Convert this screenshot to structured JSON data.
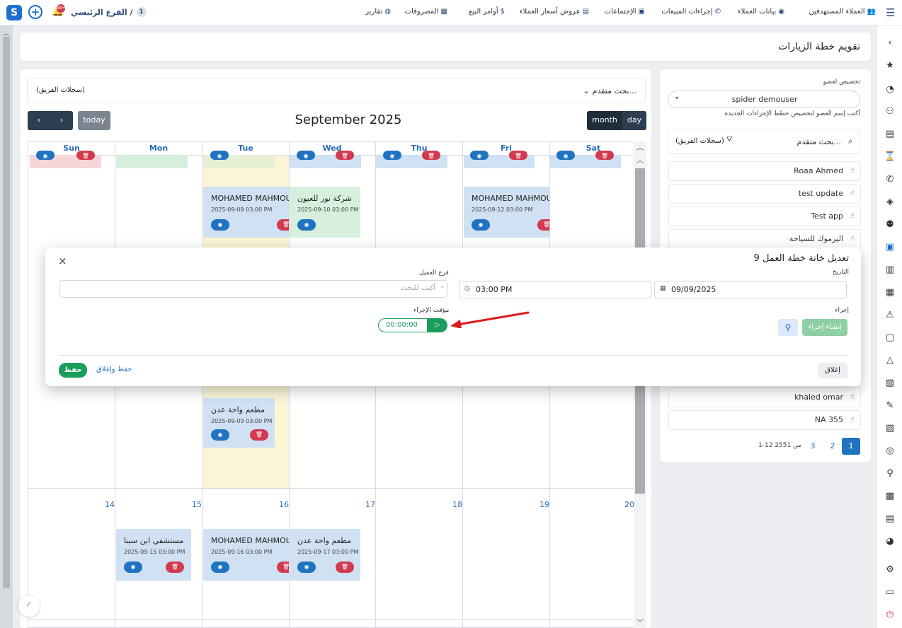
{
  "topbar": {
    "branch_label": "الفرع الرئيسي /",
    "branch_badge": "1",
    "notif_badge": "99+",
    "nav": [
      {
        "label": "العملاء المستهدفين"
      },
      {
        "label": "بيانات العملاء"
      },
      {
        "label": "إجراءات المبيعات"
      },
      {
        "label": "الإجتماعات"
      },
      {
        "label": "عروض أسعار العملاء"
      },
      {
        "label": "أوامر البيع"
      },
      {
        "label": "المصروفات"
      },
      {
        "label": "تقارير"
      }
    ]
  },
  "header": {
    "title": "تقويم خطة الزيارات"
  },
  "calendar": {
    "advanced_search": "بحث متقدم...",
    "team_records": "(سجلات الفريق)",
    "today_label": "today",
    "month_label": "month",
    "day_label": "day",
    "title": "September 2025",
    "days": [
      "Sun",
      "Mon",
      "Tue",
      "Wed",
      "Thu",
      "Fri",
      "Sat"
    ],
    "events_row1": [
      {
        "title": "MOHAMED MAHMOUD",
        "date": "2025-09-09 03:00 PM"
      },
      {
        "title": "شركة نور للعيون",
        "date": "2025-09-10 03:00 PM"
      },
      {
        "title": "MOHAMED MAHMOUD",
        "date": "2025-09-12 03:00 PM"
      }
    ],
    "event_tue_lower": {
      "title": "مطعم واحة عدن",
      "date": "2025-09-09 03:00 PM"
    },
    "week_days": [
      "14",
      "15",
      "16",
      "17",
      "18",
      "19",
      "20"
    ],
    "events_row2": [
      {
        "title": "مستشفي ابن سينا",
        "date": "2025-09-15 03:00 PM"
      },
      {
        "title": "MOHAMED MAHMOUD",
        "date": "2025-09-16 03:00 PM"
      },
      {
        "title": "مطعم واحة عدن",
        "date": "2025-09-17 03:00 PM"
      }
    ]
  },
  "sidebar": {
    "assign_label": "تخصيص لعضو",
    "member_value": "spider demouser",
    "hint": "أكتب إسم العضو لتخصيص خطط الإجراءات الجديدة",
    "advanced_search": "بحث متقدم...",
    "team_records": "(سجلات الفريق)",
    "items": [
      "Roaa Ahmed",
      "test update",
      "Test app",
      "اليرموك للسياحة",
      "khaled omar",
      "NA 355"
    ],
    "pager_info": "1-12 من 2551",
    "pages": [
      "1",
      "2",
      "3"
    ]
  },
  "modal": {
    "title": "تعديل خانة خطة العمل 9",
    "date_label": "التاريخ",
    "date_value": "09/09/2025",
    "time_value": "03:00 PM",
    "branch_label": "فرع العميل",
    "branch_placeholder": "أكتب للبحث",
    "action_label": "إجراء",
    "create_action": "إنشاء إجراء",
    "timer_label": "مؤقت الإجراء",
    "timer_value": "00:00:00",
    "close_label": "إغلاق",
    "save_close_label": "حفظ وإغلاق",
    "save_label": "حفظ"
  },
  "colors": {
    "primary": "#1a9d5c",
    "dark": "#2c3e50",
    "blue": "#1f73c0",
    "red": "#d23a4f",
    "event_blue": "#cfe1f3",
    "event_green": "#d6f0dd",
    "tue_highlight": "#fbf4d5"
  }
}
